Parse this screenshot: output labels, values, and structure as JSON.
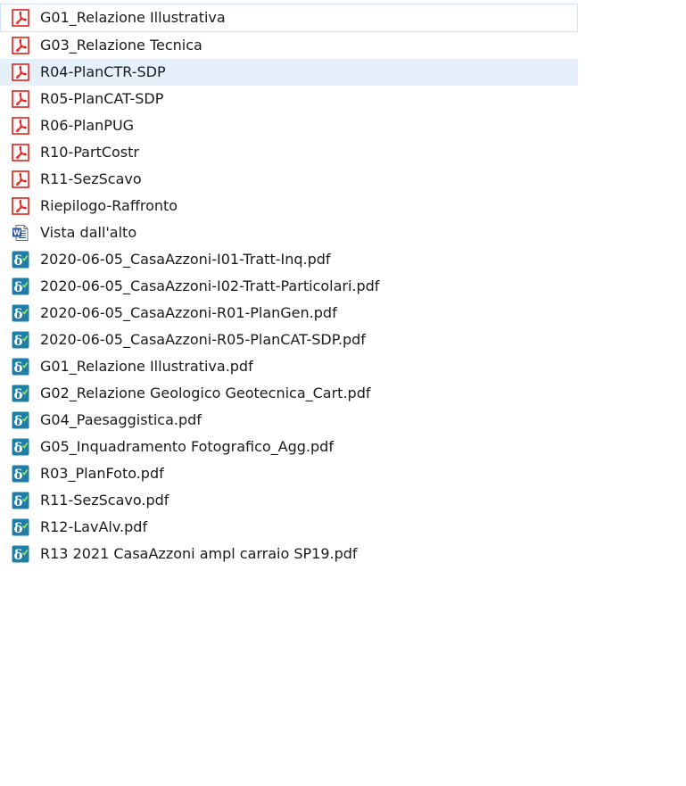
{
  "file_list": {
    "items": [
      {
        "name": "G01_Relazione Illustrativa",
        "icon": "acrobat-pdf-icon",
        "state": "focused"
      },
      {
        "name": "G03_Relazione Tecnica",
        "icon": "acrobat-pdf-icon"
      },
      {
        "name": "R04-PlanCTR-SDP",
        "icon": "acrobat-pdf-icon",
        "state": "hover"
      },
      {
        "name": "R05-PlanCAT-SDP",
        "icon": "acrobat-pdf-icon"
      },
      {
        "name": "R06-PlanPUG",
        "icon": "acrobat-pdf-icon"
      },
      {
        "name": "R10-PartCostr",
        "icon": "acrobat-pdf-icon"
      },
      {
        "name": "R11-SezScavo",
        "icon": "acrobat-pdf-icon"
      },
      {
        "name": "Riepilogo-Raffronto",
        "icon": "acrobat-pdf-icon"
      },
      {
        "name": "Vista dall'alto",
        "icon": "word-document-icon"
      },
      {
        "name": "2020-06-05_CasaAzzoni-I01-Tratt-Inq.pdf",
        "icon": "signed-pdf-icon"
      },
      {
        "name": "2020-06-05_CasaAzzoni-I02-Tratt-Particolari.pdf",
        "icon": "signed-pdf-icon"
      },
      {
        "name": "2020-06-05_CasaAzzoni-R01-PlanGen.pdf",
        "icon": "signed-pdf-icon"
      },
      {
        "name": "2020-06-05_CasaAzzoni-R05-PlanCAT-SDP.pdf",
        "icon": "signed-pdf-icon"
      },
      {
        "name": "G01_Relazione Illustrativa.pdf",
        "icon": "signed-pdf-icon"
      },
      {
        "name": "G02_Relazione Geologico Geotecnica_Cart.pdf",
        "icon": "signed-pdf-icon"
      },
      {
        "name": "G04_Paesaggistica.pdf",
        "icon": "signed-pdf-icon"
      },
      {
        "name": "G05_Inquadramento Fotografico_Agg.pdf",
        "icon": "signed-pdf-icon"
      },
      {
        "name": "R03_PlanFoto.pdf",
        "icon": "signed-pdf-icon"
      },
      {
        "name": "R11-SezScavo.pdf",
        "icon": "signed-pdf-icon"
      },
      {
        "name": "R12-LavAlv.pdf",
        "icon": "signed-pdf-icon"
      },
      {
        "name": "R13 2021 CasaAzzoni ampl carraio SP19.pdf",
        "icon": "signed-pdf-icon"
      }
    ]
  },
  "colors": {
    "hover_background": "#e5f0fb",
    "focus_border": "#cfe0f5",
    "pdf_red": "#e0201b",
    "word_blue": "#2b579a",
    "signed_teal": "#1e7fa6"
  }
}
